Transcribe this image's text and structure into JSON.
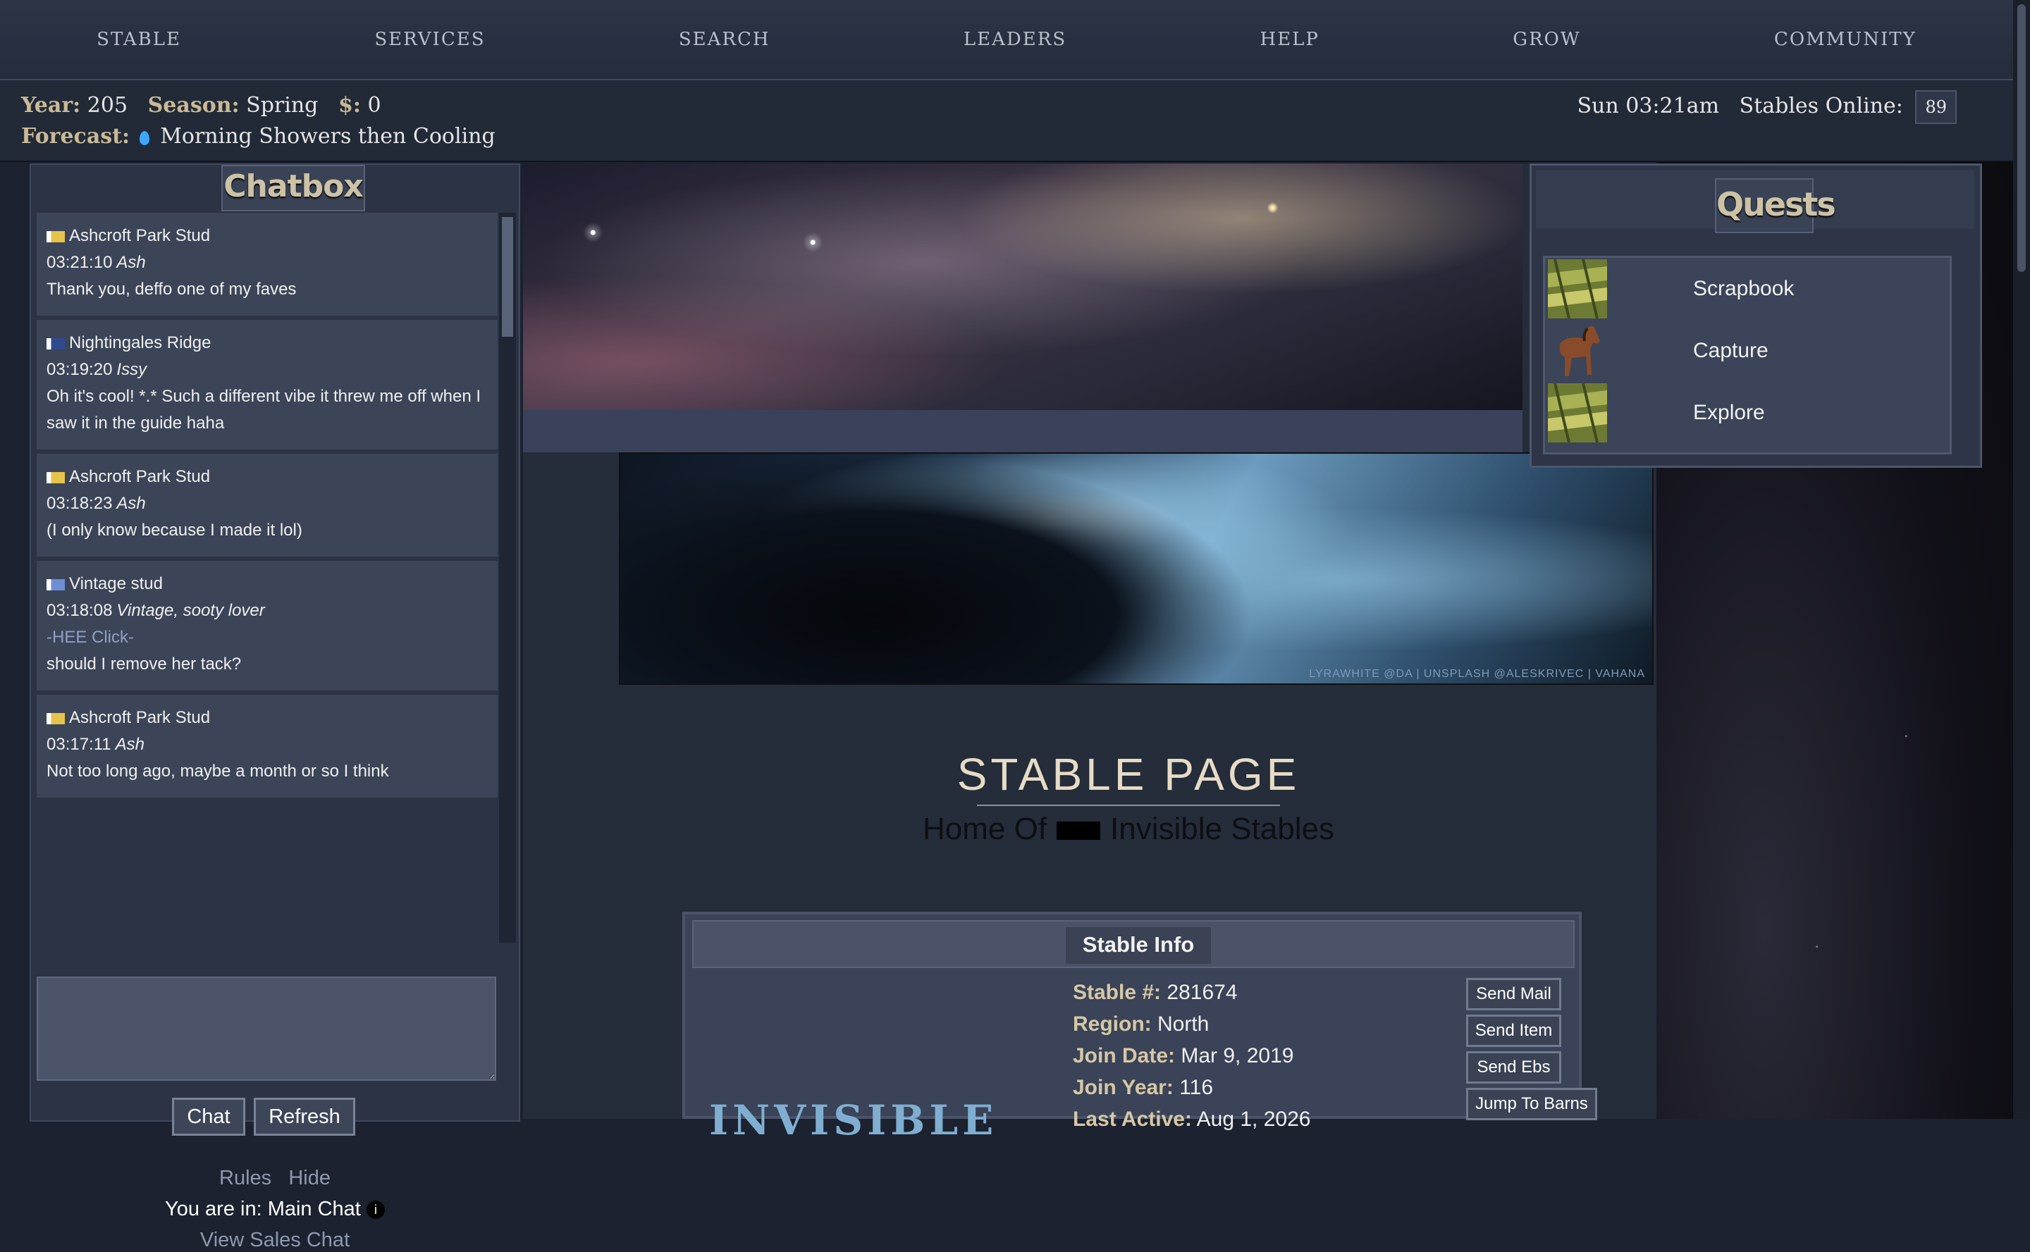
{
  "nav": [
    "STABLE",
    "SERVICES",
    "SEARCH",
    "LEADERS",
    "HELP",
    "GROW",
    "COMMUNITY"
  ],
  "status": {
    "year_label": "Year:",
    "year": "205",
    "season_label": "Season:",
    "season": "Spring",
    "money_label": "$:",
    "money": "0",
    "forecast_label": "Forecast:",
    "forecast": "Morning Showers then Cooling",
    "time": "Sun 03:21am",
    "online_label": "Stables Online:",
    "online": "89"
  },
  "chat": {
    "title": "Chatbox",
    "messages": [
      {
        "stable": "Ashcroft Park Stud",
        "time": "03:21:10",
        "user": "Ash",
        "sub": "",
        "text": "Thank you, deffo one of my faves",
        "flag": "#e6c34a"
      },
      {
        "stable": "Nightingales Ridge",
        "time": "03:19:20",
        "user": "Issy",
        "sub": "",
        "text": "Oh it's cool! *.* Such a different vibe it threw me off when I saw it in the guide haha",
        "flag": "#2f4a8f"
      },
      {
        "stable": "Ashcroft Park Stud",
        "time": "03:18:23",
        "user": "Ash",
        "sub": "",
        "text": "(I only know because I made it lol)",
        "flag": "#e6c34a"
      },
      {
        "stable": "Vintage stud",
        "time": "03:18:08",
        "user": "Vintage, sooty lover",
        "sub": "-HEE Click-",
        "text": "should I remove her tack?",
        "flag": "#6e8fd6"
      },
      {
        "stable": "Ashcroft Park Stud",
        "time": "03:17:11",
        "user": "Ash",
        "sub": "",
        "text": "Not too long ago, maybe a month or so I think",
        "flag": "#e6c34a"
      }
    ],
    "chat_button": "Chat",
    "refresh_button": "Refresh",
    "rules": "Rules",
    "hide": "Hide",
    "location": "You are in: Main Chat",
    "sales": "View Sales Chat"
  },
  "banner_credit": "LYRAWHITE @DA | UNSPLASH @ALESKRIVEC | VAHANA",
  "page": {
    "title": "STABLE PAGE",
    "home_of": "Home Of",
    "stable_name": "Invisible Stables"
  },
  "stable_info": {
    "title": "Stable Info",
    "rows": [
      {
        "k": "Stable #:",
        "v": "281674"
      },
      {
        "k": "Region:",
        "v": "North"
      },
      {
        "k": "Join Date:",
        "v": "Mar 9, 2019"
      },
      {
        "k": "Join Year:",
        "v": "116"
      },
      {
        "k": "Last Active:",
        "v": "Aug 1, 2026"
      }
    ],
    "buttons": [
      "Send Mail",
      "Send Item",
      "Send Ebs",
      "Jump To Barns"
    ],
    "logo": "INVISIBLE"
  },
  "quests": {
    "title": "Quests",
    "items": [
      {
        "label": "Scrapbook",
        "icon": "scrapbook-icon"
      },
      {
        "label": "Capture",
        "icon": "horse-icon"
      },
      {
        "label": "Explore",
        "icon": "map-icon"
      }
    ]
  }
}
